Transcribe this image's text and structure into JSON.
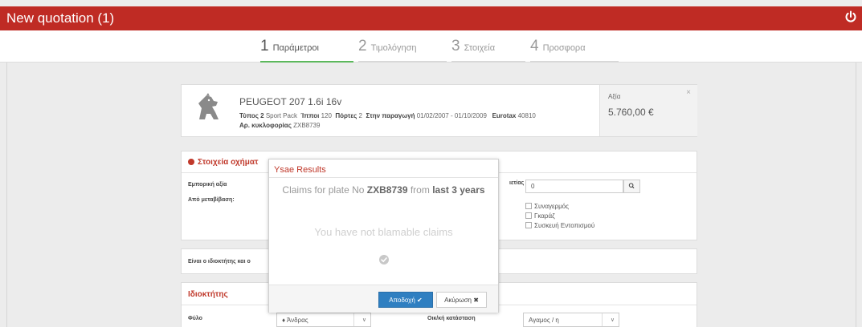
{
  "app": {
    "title": "New quotation (1)"
  },
  "steps": [
    {
      "num": "1",
      "label": "Παράμετροι"
    },
    {
      "num": "2",
      "label": "Τιμολόγηση"
    },
    {
      "num": "3",
      "label": "Στοιχεία"
    },
    {
      "num": "4",
      "label": "Προσφορα"
    }
  ],
  "car": {
    "brand": "PEUGEOT",
    "model": "207 1.6i 16v",
    "type_label": "Τύπος 2",
    "type_value": "Sport Pack",
    "hp_label": "Ίπποι",
    "hp_value": "120",
    "doors_label": "Πόρτες",
    "doors_value": "2",
    "production_label": "Στην παραγωγή",
    "production_value": "01/02/2007 - 01/10/2009",
    "eurotax_label": "Eurotax",
    "eurotax_value": "40810",
    "plate_label": "Αρ. κυκλοφορίας",
    "plate_value": "ZXB8739",
    "value_label": "Αξία",
    "value_amount": "5.760,00 €",
    "close": "×"
  },
  "vehicle_section": {
    "title": "Στοιχεία οχήματ",
    "commercial_value_label": "Εμπορική αξία",
    "transfer_label": "Από μεταβίβαση:",
    "right_label_fragment": "ιετίας",
    "right_input_value": "0",
    "checkboxes": [
      "Συναγερμός",
      "Γκαράζ",
      "Συσκευή Εντοπισμού"
    ]
  },
  "owner_question": {
    "label": "Είναι ο ιδιοκτήτης και ο"
  },
  "owner_section": {
    "title": "Ιδιοκτήτης",
    "gender_label": "Φύλο",
    "gender_value": "Άνδρας",
    "marital_label": "Οικ/κή κατάσταση",
    "marital_value": "Αγαμος / η"
  },
  "modal": {
    "title": "Ysae Results",
    "claims_prefix": "Claims for plate No",
    "claims_plate": "ZXB8739",
    "claims_middle": "from",
    "claims_period": "last 3 years",
    "message": "You have not blamable claims",
    "accept_label": "Αποδοχή ✔",
    "cancel_label": "Ακύρωση ✖"
  },
  "colors": {
    "brand_red": "#bf2b24",
    "step_active": "#5cb85c",
    "primary_button": "#2f7fc1"
  }
}
